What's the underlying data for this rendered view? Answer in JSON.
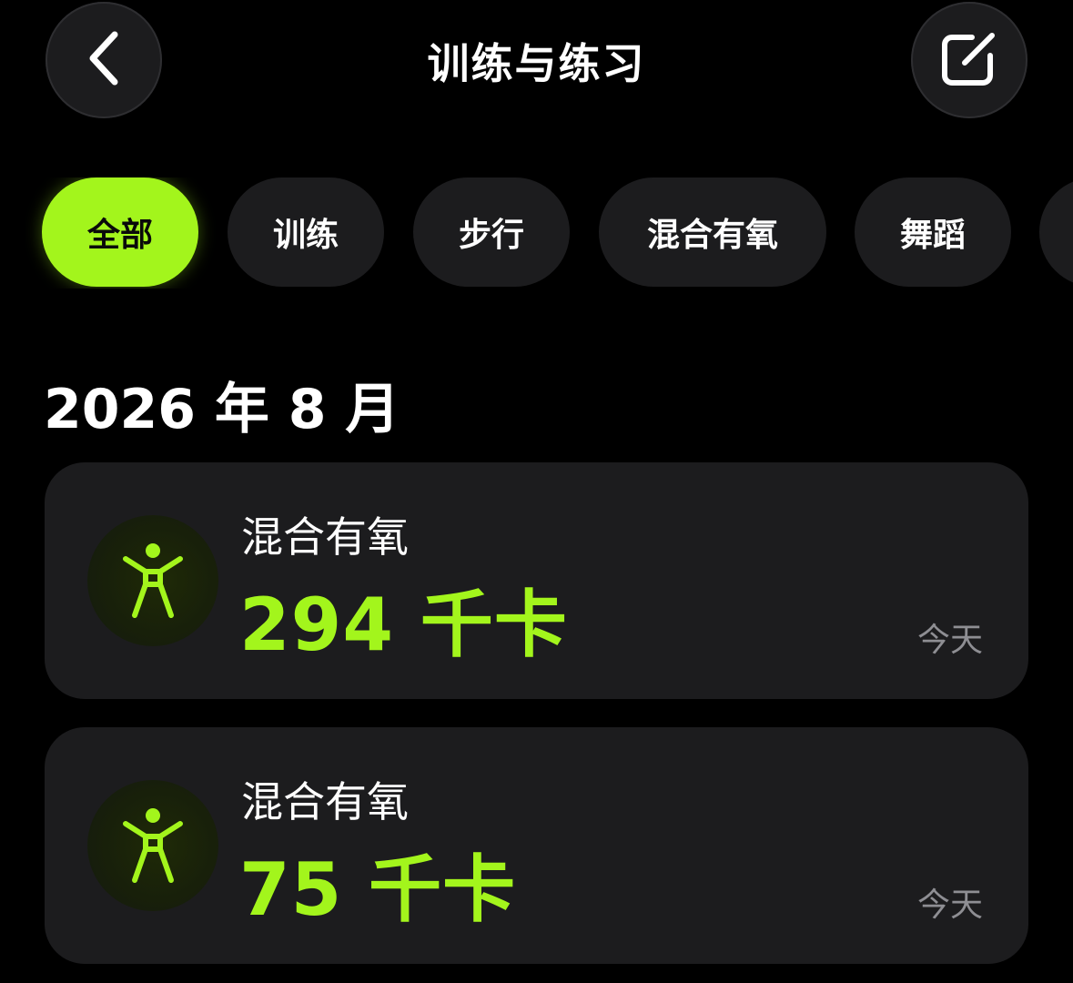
{
  "header": {
    "title": "训练与练习",
    "back_icon": "chevron-left-icon",
    "edit_icon": "compose-icon"
  },
  "filters": [
    {
      "label": "全部",
      "active": true
    },
    {
      "label": "训练",
      "active": false
    },
    {
      "label": "步行",
      "active": false
    },
    {
      "label": "混合有氧",
      "active": false
    },
    {
      "label": "舞蹈",
      "active": false
    },
    {
      "label": "",
      "active": false
    }
  ],
  "section": {
    "month": "2026 年 8 月"
  },
  "workouts": [
    {
      "name": "混合有氧",
      "value": "294 千卡",
      "date": "今天",
      "icon": "figure-cardio-icon"
    },
    {
      "name": "混合有氧",
      "value": "75 千卡",
      "date": "今天",
      "icon": "figure-cardio-icon"
    }
  ],
  "colors": {
    "accent": "#a3f51c",
    "background": "#000000",
    "surface": "#1c1c1e",
    "secondary_text": "#8e8e93"
  }
}
